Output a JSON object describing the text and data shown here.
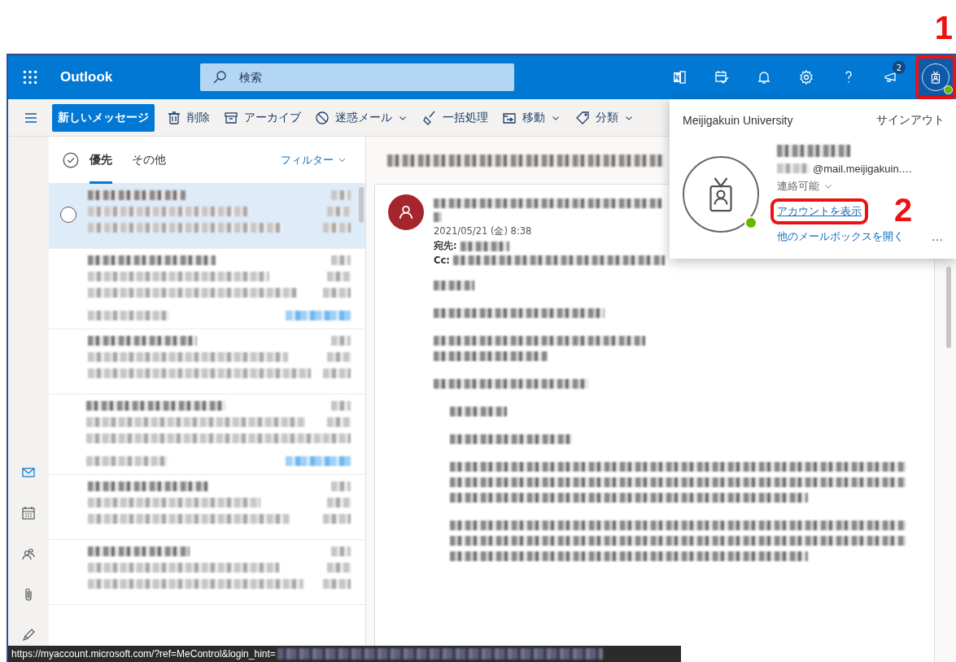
{
  "app": {
    "name": "Outlook"
  },
  "search": {
    "placeholder": "検索"
  },
  "header_icons": [
    {
      "kind": "notes"
    },
    {
      "kind": "tasks"
    },
    {
      "kind": "bell"
    },
    {
      "kind": "settings"
    },
    {
      "kind": "help"
    },
    {
      "kind": "megaphone",
      "badge": "2"
    }
  ],
  "account_button": {
    "highlighted": true,
    "online": true,
    "annotation": "1"
  },
  "toolbar": {
    "new_message": "新しいメッセージ",
    "actions": [
      {
        "kind": "delete",
        "label": "削除",
        "dropdown": false
      },
      {
        "kind": "archive",
        "label": "アーカイブ",
        "dropdown": false
      },
      {
        "kind": "junk",
        "label": "迷惑メール",
        "dropdown": true
      },
      {
        "kind": "sweep",
        "label": "一括処理",
        "dropdown": false
      },
      {
        "kind": "move",
        "label": "移動",
        "dropdown": true
      },
      {
        "kind": "category",
        "label": "分類",
        "dropdown": true
      }
    ]
  },
  "rail": [
    {
      "kind": "mail",
      "selected": true
    },
    {
      "kind": "calendar",
      "selected": false
    },
    {
      "kind": "people",
      "selected": false
    },
    {
      "kind": "attachment",
      "selected": false
    },
    {
      "kind": "todo",
      "selected": false
    }
  ],
  "tabs": [
    {
      "label": "優先",
      "selected": true
    },
    {
      "label": "その他",
      "selected": false
    }
  ],
  "filter": "フィルター",
  "messages": [
    {
      "selected": true,
      "tag": false
    },
    {
      "selected": false,
      "tag": true
    },
    {
      "selected": false,
      "tag": false
    },
    {
      "selected": false,
      "tag": true
    },
    {
      "selected": false,
      "tag": false
    },
    {
      "selected": false,
      "tag": false
    }
  ],
  "reading": {
    "date": "2021/05/21 (金) 8:38",
    "to_label": "宛先:",
    "cc_label": "Cc:"
  },
  "account_panel": {
    "organization": "Meijigakuin University",
    "sign_out": "サインアウト",
    "online": true,
    "email": "@mail.meijigakuin.…",
    "status": "連絡可能",
    "view_account": {
      "label": "アカウントを表示",
      "highlighted": true,
      "annotation": "2"
    },
    "other_mailbox": "他のメールボックスを開く",
    "more": "…"
  },
  "status_bar": {
    "url": "https://myaccount.microsoft.com/?ref=MeControl&login_hint="
  }
}
